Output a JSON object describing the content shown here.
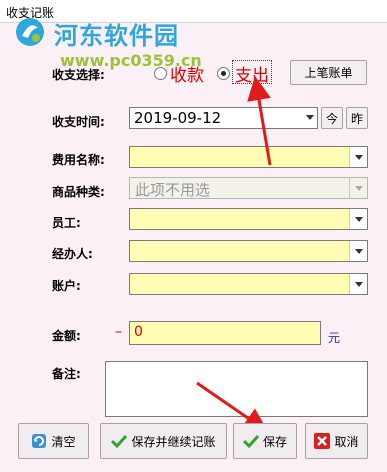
{
  "window": {
    "title": "收支记账"
  },
  "watermark": {
    "name": "河东软件园",
    "url": "www.pc0359.cn"
  },
  "form": {
    "type_label": "收支选择:",
    "radio_income": "收款",
    "radio_expense": "支出",
    "selected": "支出",
    "history_button": "上笔账单",
    "time_label": "收支时间:",
    "date_value": "2019-09-12",
    "today_button": "今",
    "yesterday_button": "昨",
    "expense_name_label": "费用名称:",
    "expense_name_value": "",
    "goods_type_label": "商品种类:",
    "goods_type_value": "此项不用选",
    "employee_label": "员工:",
    "employee_value": "",
    "handler_label": "经办人:",
    "handler_value": "",
    "account_label": "账户:",
    "account_value": "",
    "amount_label": "金额:",
    "amount_sign": "–",
    "amount_value": "0",
    "amount_unit": "元",
    "note_label": "备注:",
    "note_value": ""
  },
  "buttons": {
    "clear": "清空",
    "save_continue": "保存并继续记账",
    "save": "保存",
    "cancel": "取消"
  },
  "colors": {
    "field_bg": "#fffdb4",
    "window_bg": "#fcf0f7",
    "accent_red": "#e00000",
    "unit_blue": "#1a35c8"
  }
}
